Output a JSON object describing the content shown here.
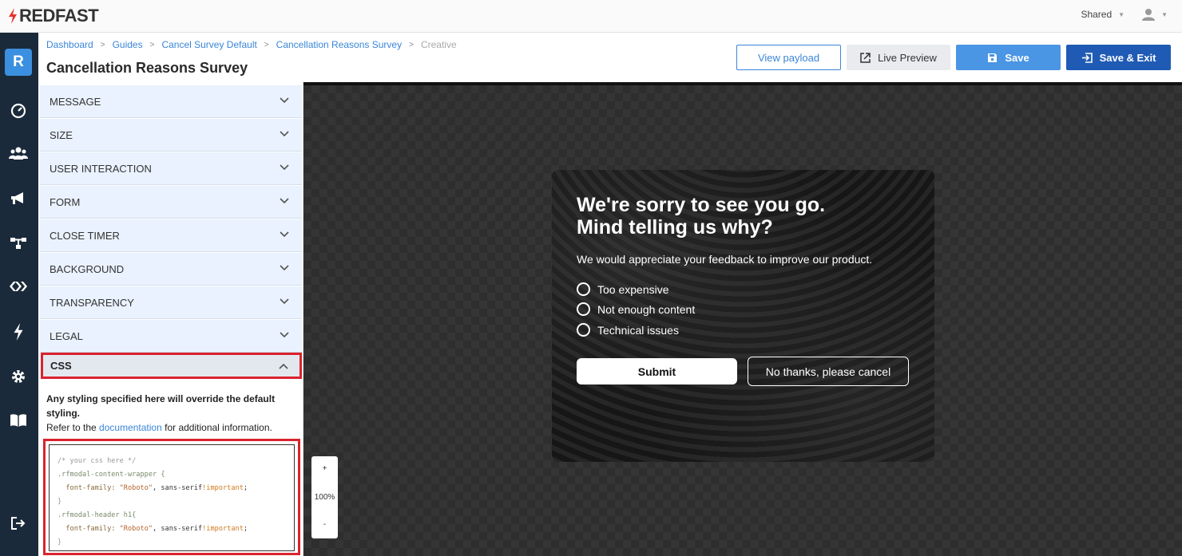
{
  "topbar": {
    "brand": "REDFAST",
    "workspace": "Shared",
    "brand_color": "#e8332a"
  },
  "rail": {
    "avatar_letter": "R",
    "icons": [
      "speedometer-icon",
      "users-icon",
      "megaphone-icon",
      "flow-icon",
      "chevrons-icon",
      "bolt-icon",
      "gear-icon",
      "book-icon",
      "logout-icon"
    ]
  },
  "breadcrumb": {
    "items": [
      "Dashboard",
      "Guides",
      "Cancel Survey Default",
      "Cancellation Reasons Survey"
    ],
    "current": "Creative"
  },
  "page": {
    "title": "Cancellation Reasons Survey"
  },
  "actions": {
    "view_payload": "View payload",
    "live_preview": "Live Preview",
    "save": "Save",
    "save_exit": "Save & Exit"
  },
  "accordion": {
    "sections": [
      "MESSAGE",
      "SIZE",
      "USER INTERACTION",
      "FORM",
      "CLOSE TIMER",
      "BACKGROUND",
      "TRANSPARENCY",
      "LEGAL"
    ],
    "open_section": "CSS"
  },
  "css_panel": {
    "description_bold": "Any styling specified here will override the default styling.",
    "refer_prefix": "Refer to the ",
    "refer_link": "documentation",
    "refer_suffix": " for additional information.",
    "code": {
      "comment": "/* your css here */",
      "sel1": ".rfmodal-content-wrapper {",
      "prop": "font-family: ",
      "str": "\"Roboto\"",
      "rest": ", sans-serif",
      "imp": "!important",
      "semi": ";",
      "close": "}",
      "sel2": ".rfmodal-header h1{"
    }
  },
  "zoom": {
    "plus": "+",
    "level": "100%",
    "minus": "-"
  },
  "modal": {
    "heading_line1": "We're sorry to see you go.",
    "heading_line2": "Mind telling us why?",
    "subtext": "We would appreciate your feedback to improve our product.",
    "options": [
      "Too expensive",
      "Not enough content",
      "Technical issues"
    ],
    "submit": "Submit",
    "cancel": "No thanks, please cancel"
  }
}
